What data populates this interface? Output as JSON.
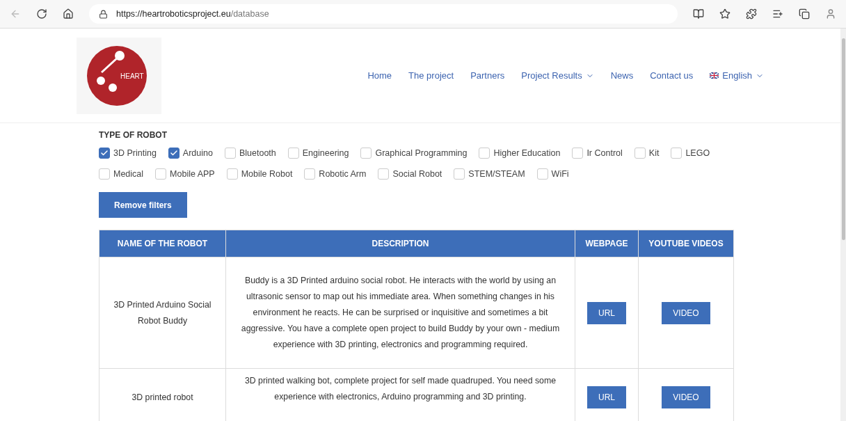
{
  "browser": {
    "url_host": "https://heartroboticsproject.eu",
    "url_path": "/database"
  },
  "header": {
    "logo_text": "HEART",
    "nav": [
      {
        "label": "Home",
        "dropdown": false,
        "flag": false
      },
      {
        "label": "The project",
        "dropdown": false,
        "flag": false
      },
      {
        "label": "Partners",
        "dropdown": false,
        "flag": false
      },
      {
        "label": "Project Results",
        "dropdown": true,
        "flag": false
      },
      {
        "label": "News",
        "dropdown": false,
        "flag": false
      },
      {
        "label": "Contact us",
        "dropdown": false,
        "flag": false
      },
      {
        "label": "English",
        "dropdown": true,
        "flag": true
      }
    ]
  },
  "filters": {
    "title": "TYPE OF ROBOT",
    "rows": [
      [
        {
          "label": "3D Printing",
          "checked": true
        },
        {
          "label": "Arduino",
          "checked": true
        },
        {
          "label": "Bluetooth",
          "checked": false
        },
        {
          "label": "Engineering",
          "checked": false
        },
        {
          "label": "Graphical Programming",
          "checked": false
        },
        {
          "label": "Higher Education",
          "checked": false
        },
        {
          "label": "Ir Control",
          "checked": false
        },
        {
          "label": "Kit",
          "checked": false
        },
        {
          "label": "LEGO",
          "checked": false
        }
      ],
      [
        {
          "label": "Medical",
          "checked": false
        },
        {
          "label": "Mobile APP",
          "checked": false
        },
        {
          "label": "Mobile Robot",
          "checked": false
        },
        {
          "label": "Robotic Arm",
          "checked": false
        },
        {
          "label": "Social Robot",
          "checked": false
        },
        {
          "label": "STEM/STEAM",
          "checked": false
        },
        {
          "label": "WiFi",
          "checked": false
        }
      ]
    ],
    "remove_button": "Remove filters"
  },
  "table": {
    "columns": [
      "NAME OF THE ROBOT",
      "DESCRIPTION",
      "WEBPAGE",
      "YOUTUBE VIDEOS"
    ],
    "rows": [
      {
        "name": "3D Printed Arduino Social Robot Buddy",
        "description": "Buddy is a 3D Printed arduino social robot. He interacts with the world by using an ultrasonic sensor to map out his immediate area. When something changes in his environment he reacts. He can be surprised or inquisitive and sometimes a bit aggressive. You have a complete open project to build Buddy by your own - medium experience with 3D printing, electronics and programming required.",
        "webpage": "URL",
        "video": "VIDEO"
      },
      {
        "name": "3D printed robot",
        "description": "3D printed walking bot, complete project for self made quadruped. You need some experience with electronics, Arduino programming and 3D printing.",
        "webpage": "URL",
        "video": "VIDEO"
      }
    ]
  }
}
